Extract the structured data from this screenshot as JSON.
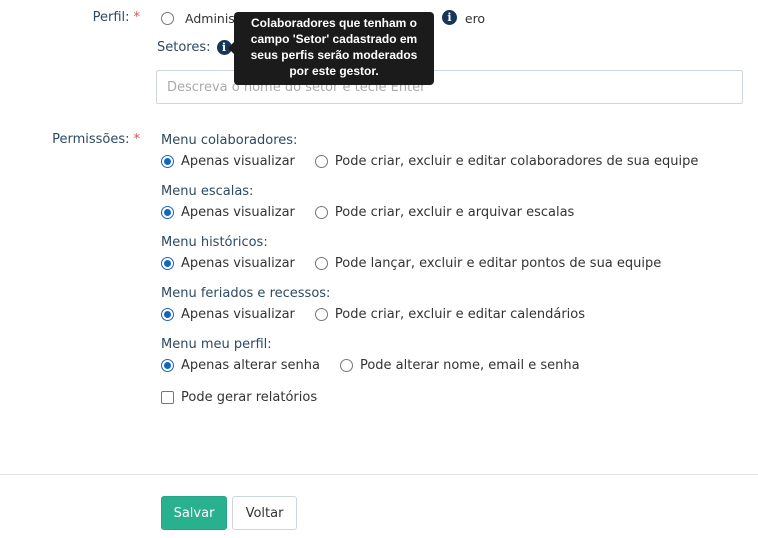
{
  "perfil": {
    "label": "Perfil:",
    "required_mark": "*",
    "option_label": "Administr",
    "option_trail": "ero"
  },
  "setores": {
    "label": "Setores:",
    "input_placeholder": "Descreva o nome do setor e tecle Enter"
  },
  "tooltip": {
    "text": "Colaboradores que tenham o campo 'Setor' cadastrado em seus perfis serão moderados por este gestor."
  },
  "permissoes": {
    "label": "Permissões:",
    "required_mark": "*",
    "groups": [
      {
        "title": "Menu colaboradores:",
        "option_a": "Apenas visualizar",
        "option_b": "Pode criar, excluir e editar colaboradores de sua equipe"
      },
      {
        "title": "Menu escalas:",
        "option_a": "Apenas visualizar",
        "option_b": "Pode criar, excluir e arquivar escalas"
      },
      {
        "title": "Menu históricos:",
        "option_a": "Apenas visualizar",
        "option_b": "Pode lançar, excluir e editar pontos de sua equipe"
      },
      {
        "title": "Menu feriados e recessos:",
        "option_a": "Apenas visualizar",
        "option_b": "Pode criar, excluir e editar calendários"
      },
      {
        "title": "Menu meu perfil:",
        "option_a": "Apenas alterar senha",
        "option_b": "Pode alterar nome, email e senha"
      }
    ],
    "relatorios_label": "Pode gerar relatórios"
  },
  "actions": {
    "save_label": "Salvar",
    "back_label": "Voltar"
  },
  "colors": {
    "primary": "#28b08f",
    "radio_selected": "#1565c0",
    "label_text": "#2c4a63",
    "required": "#d9534f",
    "info_icon": "#16365a",
    "tooltip_bg": "#1b1b1b"
  },
  "icons": {
    "info": "info-circle-icon"
  }
}
